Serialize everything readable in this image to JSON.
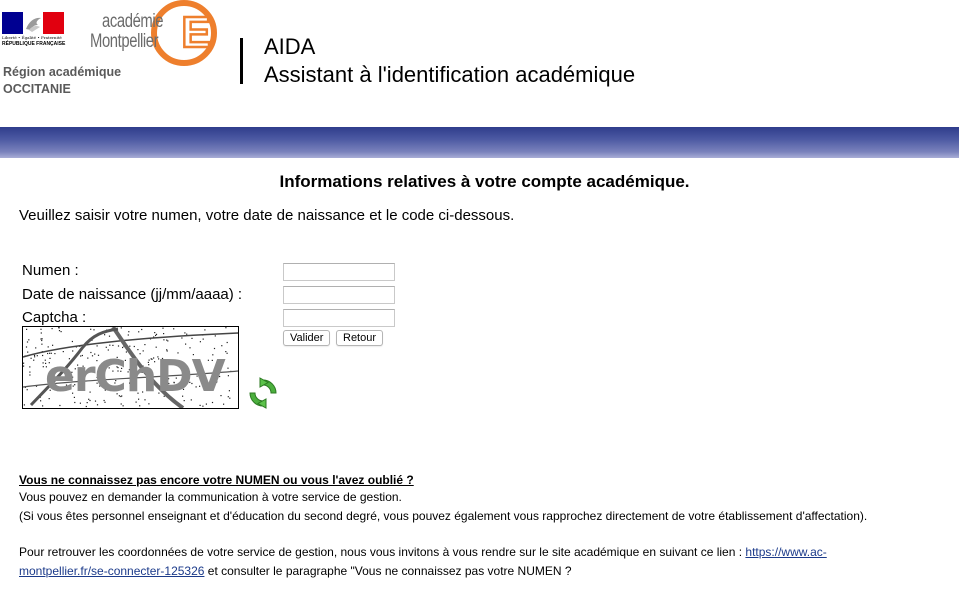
{
  "header": {
    "rf_motto": "Liberté • Égalité • Fraternité",
    "rf_name": "RÉPUBLIQUE FRANÇAISE",
    "region_line1": "Région académique",
    "region_line2": "OCCITANIE",
    "academie_line1": "académie",
    "academie_line2": "Montpellier",
    "academie_letter": "E",
    "app_name": "AIDA",
    "app_subtitle": "Assistant à l'identification académique"
  },
  "colors": {
    "band_top": "#2f3d8c",
    "band_bottom": "#a9aed6",
    "academie_orange": "#ee7f2d",
    "link": "#1b3a8a",
    "flag_blue": "#000091",
    "flag_red": "#e1000f"
  },
  "main": {
    "heading": "Informations relatives à votre compte académique.",
    "instructions": "Veuillez saisir votre numen, votre date de naissance et le code ci-dessous."
  },
  "form": {
    "numen_label": "Numen :",
    "numen_value": "",
    "birthdate_label": "Date de naissance (jj/mm/aaaa) :",
    "birthdate_value": "",
    "captcha_label": "Captcha :",
    "captcha_value": "",
    "captcha_text": "erChDV",
    "submit_label": "Valider",
    "back_label": "Retour",
    "refresh_icon": "refresh-icon"
  },
  "help": {
    "question": "Vous ne connaissez pas encore votre NUMEN ou vous l'avez oublié ?",
    "line1": "Vous pouvez en demander la communication à votre service de gestion.",
    "line2": "(Si vous êtes personnel enseignant et d'éducation du second degré, vous pouvez également vous rapprochez directement de votre établissement d'affectation).",
    "line3_prefix": "Pour retrouver les coordonnées de votre service de gestion, nous vous invitons à vous rendre sur le site académique en suivant ce lien : ",
    "link_part1": "https://www.ac-",
    "link_part2": "montpellier.fr/se-connecter-125326",
    "line4_suffix": " et consulter le paragraphe \"Vous ne connaissez pas votre NUMEN ?"
  }
}
